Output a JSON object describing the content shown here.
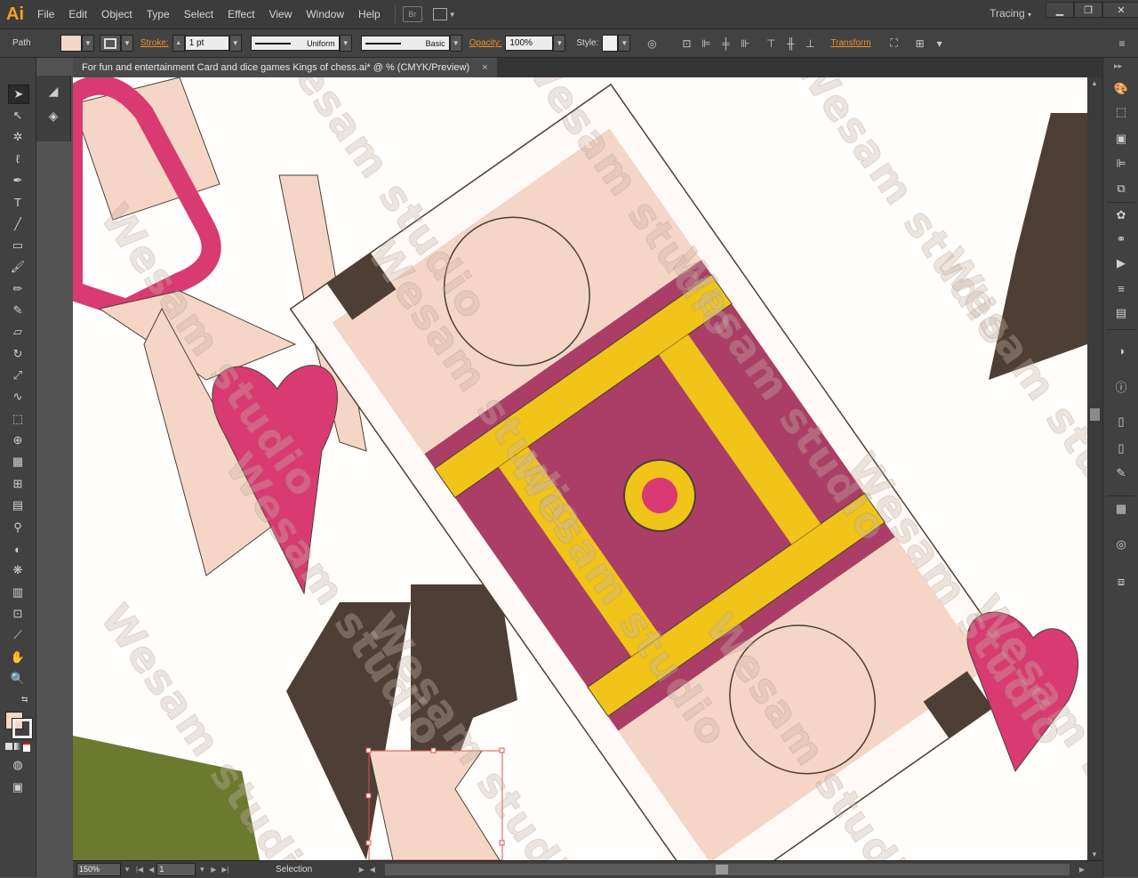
{
  "app": {
    "logo": "Ai"
  },
  "menu": [
    "File",
    "Edit",
    "Object",
    "Type",
    "Select",
    "Effect",
    "View",
    "Window",
    "Help"
  ],
  "bridge_button": "Br",
  "workspace": {
    "label": "Tracing"
  },
  "window_controls": {
    "minimize": "▁",
    "restore": "❐",
    "close": "✕"
  },
  "control_bar": {
    "selection_label": "Path",
    "stroke_label": "Stroke:",
    "stroke_weight": "1 pt",
    "profile": "Uniform",
    "brush": "Basic",
    "opacity_label": "Opacity:",
    "opacity_value": "100%",
    "style_label": "Style:",
    "transform_label": "Transform",
    "fill_color": "#f5d6c6"
  },
  "document": {
    "tab_title": "For fun and entertainment Card and dice games Kings of chess.ai* @ % (CMYK/Preview)",
    "close": "×"
  },
  "status": {
    "zoom": "150%",
    "page": "1",
    "tool": "Selection"
  },
  "watermark": {
    "text": "Wesam studio"
  },
  "tools": [
    "selection-tool",
    "direct-selection-tool",
    "magic-wand-tool",
    "lasso-tool",
    "pen-tool",
    "type-tool",
    "line-tool",
    "rectangle-tool",
    "paintbrush-tool",
    "pencil-tool",
    "blob-brush-tool",
    "eraser-tool",
    "rotate-tool",
    "scale-tool",
    "warp-tool",
    "free-transform-tool",
    "shape-builder-tool",
    "perspective-grid-tool",
    "mesh-tool",
    "gradient-tool",
    "eyedropper-tool",
    "blend-tool",
    "symbol-sprayer-tool",
    "column-graph-tool",
    "artboard-tool",
    "slice-tool",
    "hand-tool",
    "zoom-tool"
  ],
  "colors": {
    "heart_pink": "#d93a72",
    "skin": "#f5d6c6",
    "maroon": "#9b1c4c",
    "gold": "#f0c419",
    "dark_brown": "#4d3f36"
  }
}
